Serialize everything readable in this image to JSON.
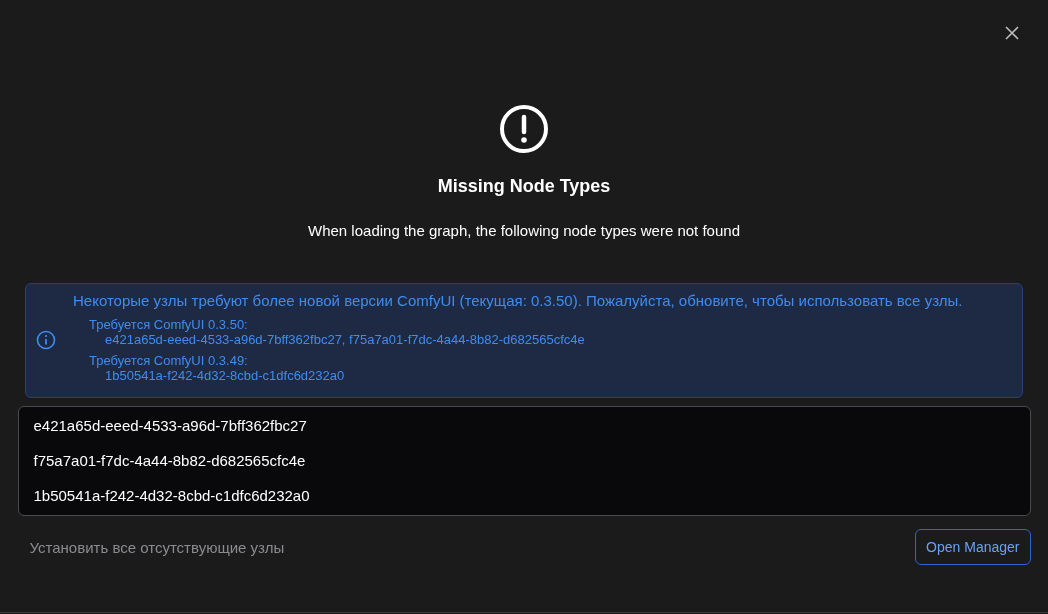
{
  "dialog": {
    "title": "Missing Node Types",
    "subtitle": "When loading the graph, the following node types were not found"
  },
  "alert": {
    "message": "Некоторые узлы требуют более новой версии ComfyUI (текущая: 0.3.50). Пожалуйста, обновите, чтобы использовать все узлы.",
    "groups": [
      {
        "label": "Требуется ComfyUI 0.3.50:",
        "nodes": "e421a65d-eeed-4533-a96d-7bff362fbc27, f75a7a01-f7dc-4a44-8b82-d682565cfc4e"
      },
      {
        "label": "Требуется ComfyUI 0.3.49:",
        "nodes": "1b50541a-f242-4d32-8cbd-c1dfc6d232a0"
      }
    ]
  },
  "node_list": [
    "e421a65d-eeed-4533-a96d-7bff362fbc27",
    "f75a7a01-f7dc-4a44-8b82-d682565cfc4e",
    "1b50541a-f242-4d32-8cbd-c1dfc6d232a0"
  ],
  "footer": {
    "install_all": {
      "label": "Установить все отсутствующие узлы",
      "disabled": true
    },
    "open_manager": {
      "label": "Open Manager"
    }
  }
}
